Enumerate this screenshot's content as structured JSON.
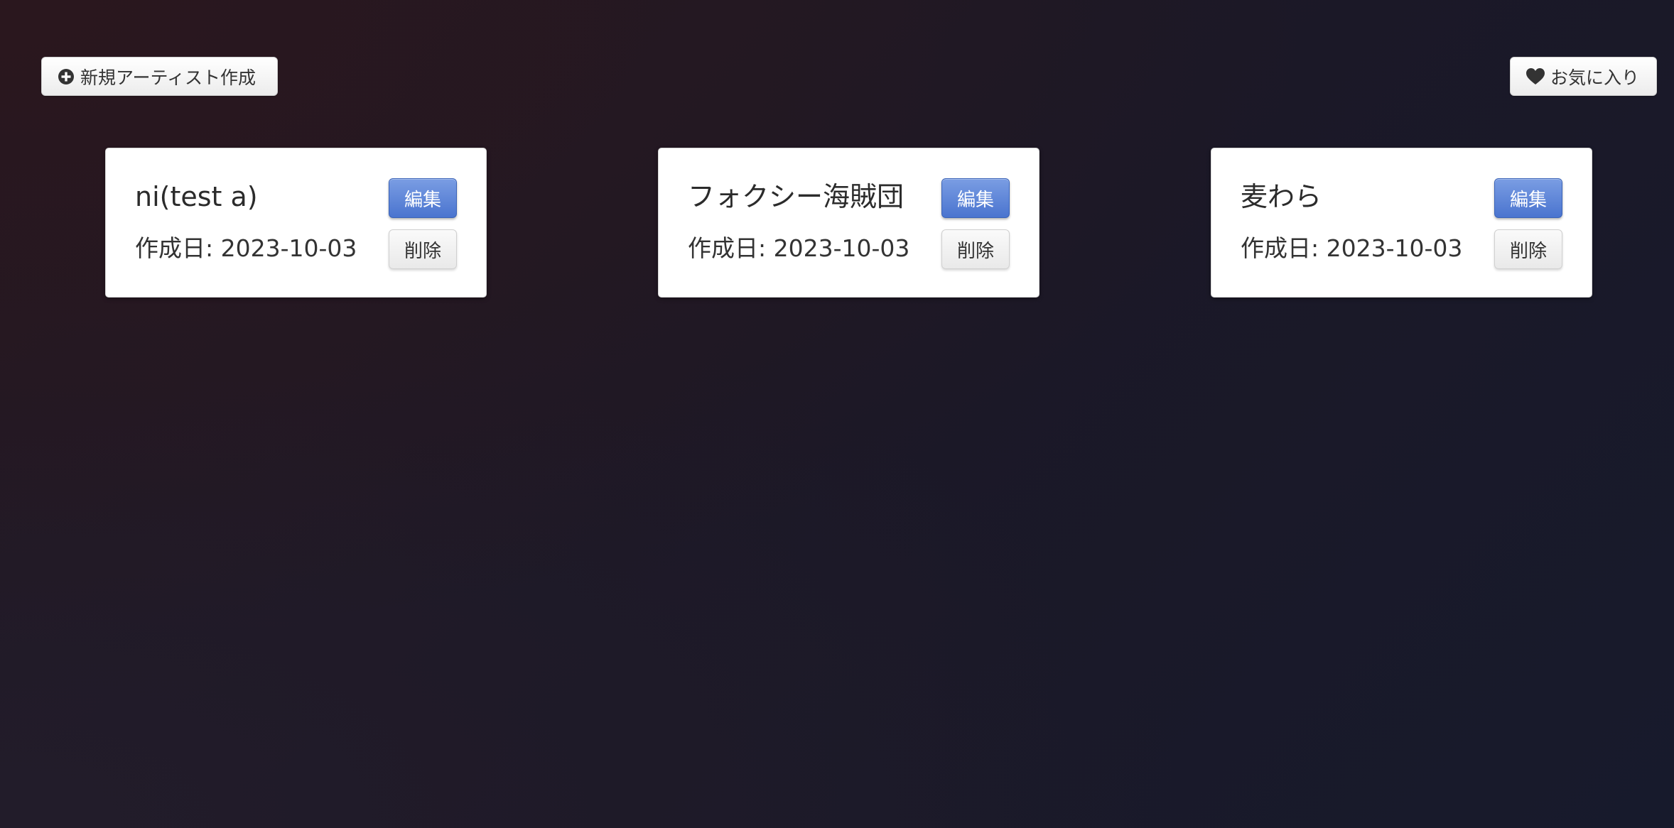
{
  "header": {
    "new_artist_label": "新規アーティスト作成",
    "new_artist_icon": "plus-circle-icon",
    "favorites_label": "お気に入り",
    "favorites_icon": "heart-icon"
  },
  "artists": [
    {
      "name": "ni(test a)",
      "created": "作成日: 2023-10-03",
      "edit_label": "編集",
      "delete_label": "削除"
    },
    {
      "name": "フォクシー海賊団",
      "created": "作成日: 2023-10-03",
      "edit_label": "編集",
      "delete_label": "削除"
    },
    {
      "name": "麦わら",
      "created": "作成日: 2023-10-03",
      "edit_label": "編集",
      "delete_label": "削除"
    }
  ],
  "colors": {
    "edit_button": "#5a82d8",
    "card_background": "#ffffff"
  }
}
